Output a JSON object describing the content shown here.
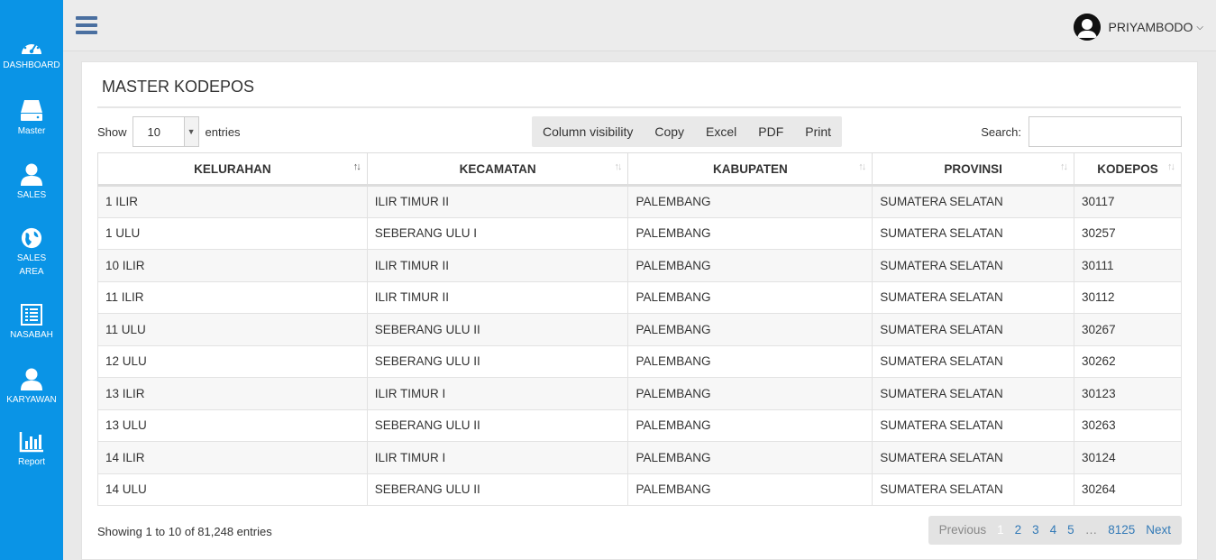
{
  "sidebar": {
    "items": [
      {
        "label": "DASHBOARD",
        "icon": "dashboard-icon"
      },
      {
        "label": "Master",
        "icon": "drive-icon"
      },
      {
        "label": "SALES",
        "icon": "user-icon"
      },
      {
        "label": "SALES\nAREA",
        "icon": "globe-icon"
      },
      {
        "label": "NASABAH",
        "icon": "list-icon"
      },
      {
        "label": "KARYAWAN",
        "icon": "user-icon"
      },
      {
        "label": "Report",
        "icon": "bar-chart-icon"
      }
    ]
  },
  "topbar": {
    "username": "PRIYAMBODO"
  },
  "panel": {
    "title": "MASTER KODEPOS"
  },
  "length": {
    "show_label": "Show",
    "value": "10",
    "entries_label": "entries"
  },
  "buttons": [
    "Column visibility",
    "Copy",
    "Excel",
    "PDF",
    "Print"
  ],
  "search": {
    "label": "Search:",
    "value": "",
    "placeholder": ""
  },
  "table": {
    "columns": [
      "KELURAHAN",
      "KECAMATAN",
      "KABUPATEN",
      "PROVINSI",
      "KODEPOS"
    ],
    "rows": [
      [
        "1 ILIR",
        "ILIR TIMUR II",
        "PALEMBANG",
        "SUMATERA SELATAN",
        "30117"
      ],
      [
        "1 ULU",
        "SEBERANG ULU I",
        "PALEMBANG",
        "SUMATERA SELATAN",
        "30257"
      ],
      [
        "10 ILIR",
        "ILIR TIMUR II",
        "PALEMBANG",
        "SUMATERA SELATAN",
        "30111"
      ],
      [
        "11 ILIR",
        "ILIR TIMUR II",
        "PALEMBANG",
        "SUMATERA SELATAN",
        "30112"
      ],
      [
        "11 ULU",
        "SEBERANG ULU II",
        "PALEMBANG",
        "SUMATERA SELATAN",
        "30267"
      ],
      [
        "12 ULU",
        "SEBERANG ULU II",
        "PALEMBANG",
        "SUMATERA SELATAN",
        "30262"
      ],
      [
        "13 ILIR",
        "ILIR TIMUR I",
        "PALEMBANG",
        "SUMATERA SELATAN",
        "30123"
      ],
      [
        "13 ULU",
        "SEBERANG ULU II",
        "PALEMBANG",
        "SUMATERA SELATAN",
        "30263"
      ],
      [
        "14 ILIR",
        "ILIR TIMUR I",
        "PALEMBANG",
        "SUMATERA SELATAN",
        "30124"
      ],
      [
        "14 ULU",
        "SEBERANG ULU II",
        "PALEMBANG",
        "SUMATERA SELATAN",
        "30264"
      ]
    ]
  },
  "info": "Showing 1 to 10 of 81,248 entries",
  "pagination": {
    "previous": "Previous",
    "pages": [
      "1",
      "2",
      "3",
      "4",
      "5",
      "…",
      "8125"
    ],
    "current": "1",
    "next": "Next"
  },
  "colors": {
    "sidebar": "#0a94e6",
    "link": "#337ab7"
  }
}
